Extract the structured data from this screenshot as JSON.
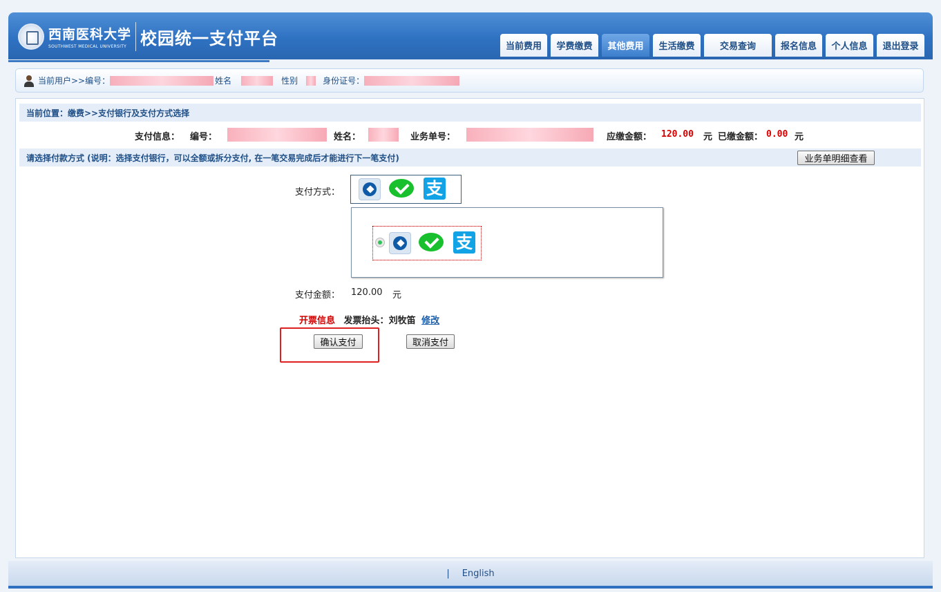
{
  "header": {
    "school_cn": "西南医科大学",
    "school_en": "SOUTHWEST MEDICAL UNIVERSITY",
    "platform_title": "校园统一支付平台"
  },
  "nav": {
    "tabs": [
      {
        "label": "当前费用",
        "active": false
      },
      {
        "label": "学费缴费",
        "active": false
      },
      {
        "label": "其他费用",
        "active": true
      },
      {
        "label": "生活缴费",
        "active": false
      },
      {
        "label": "交易查询",
        "active": false
      },
      {
        "label": "报名信息",
        "active": false
      },
      {
        "label": "个人信息",
        "active": false
      },
      {
        "label": "退出登录",
        "active": false
      }
    ]
  },
  "userbar": {
    "prefix": "当前用户>>编号：",
    "name_label": "姓名",
    "gender_label": "性别",
    "id_label": "身份证号："
  },
  "breadcrumb": "当前位置：缴费>>支付银行及支付方式选择",
  "payinfo": {
    "title": "支付信息：",
    "id_label": "编号：",
    "name_label": "姓名：",
    "order_label": "业务单号：",
    "due_label": "应缴金额：",
    "due_value": "120.00",
    "currency1": "元",
    "paid_label": "已缴金额：",
    "paid_value": "0.00",
    "currency2": "元"
  },
  "method_bar": {
    "text": "请选择付款方式 (说明：选择支付银行，可以全额或拆分支付, 在一笔交易完成后才能进行下一笔支付)",
    "detail_button": "业务单明细查看"
  },
  "payment": {
    "method_label": "支付方式：",
    "icons": [
      "ccb-bank-icon",
      "wechat-pay-icon",
      "alipay-icon"
    ],
    "alipay_glyph": "支",
    "amount_label": "支付金额：",
    "amount_value": "120.00",
    "amount_unit": "元"
  },
  "invoice": {
    "label": "开票信息",
    "title_label": "发票抬头：",
    "title_value": "刘牧笛",
    "edit_link": "修改"
  },
  "actions": {
    "confirm": "确认支付",
    "cancel": "取消支付"
  },
  "footer": {
    "separator": "|",
    "language_link": "English"
  },
  "colors": {
    "brand_blue": "#2f72c2",
    "amount_red": "#d40000",
    "highlight_red": "#e02020"
  }
}
